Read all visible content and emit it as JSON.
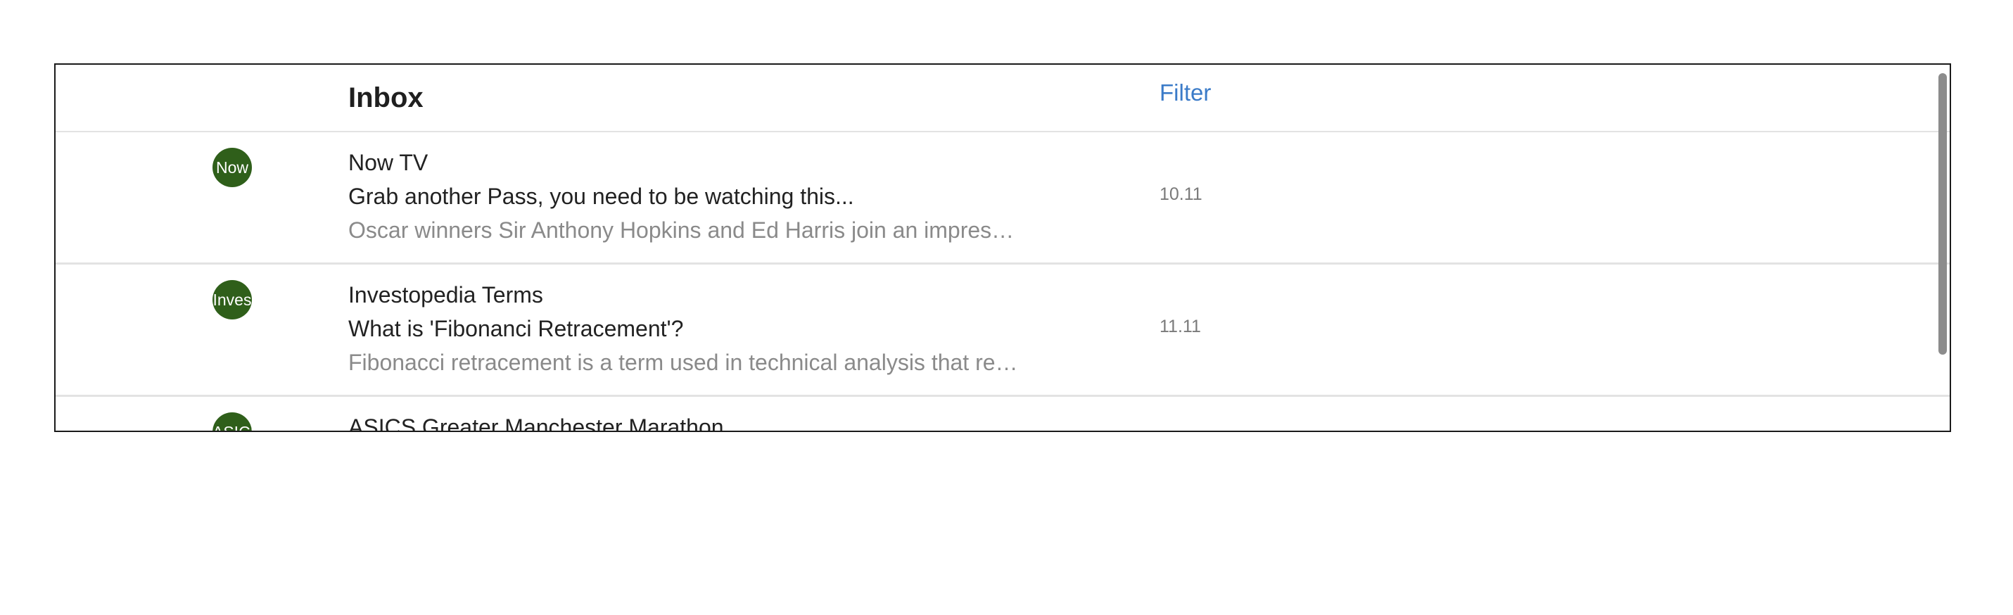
{
  "inbox": {
    "title": "Inbox",
    "filter_label": "Filter"
  },
  "messages": [
    {
      "avatar_text": "Now",
      "sender": "Now TV",
      "subject": "Grab another Pass, you need to be watching this...",
      "preview": "Oscar winners Sir Anthony Hopkins and Ed Harris join an impressiv...",
      "time": "10.11"
    },
    {
      "avatar_text": "Inves",
      "sender": "Investopedia Terms",
      "subject": "What is 'Fibonanci Retracement'?",
      "preview": "Fibonacci retracement is a term used in technical analysis that refe...",
      "time": "11.11"
    },
    {
      "avatar_text": "ASICS",
      "sender": "ASICS Greater Manchester Marathon"
    }
  ],
  "colors": {
    "avatar_bg": "#2f5f1a",
    "filter_link": "#3b7bc8",
    "divider": "#e3e3e3",
    "frame_border": "#1a1a1a"
  }
}
